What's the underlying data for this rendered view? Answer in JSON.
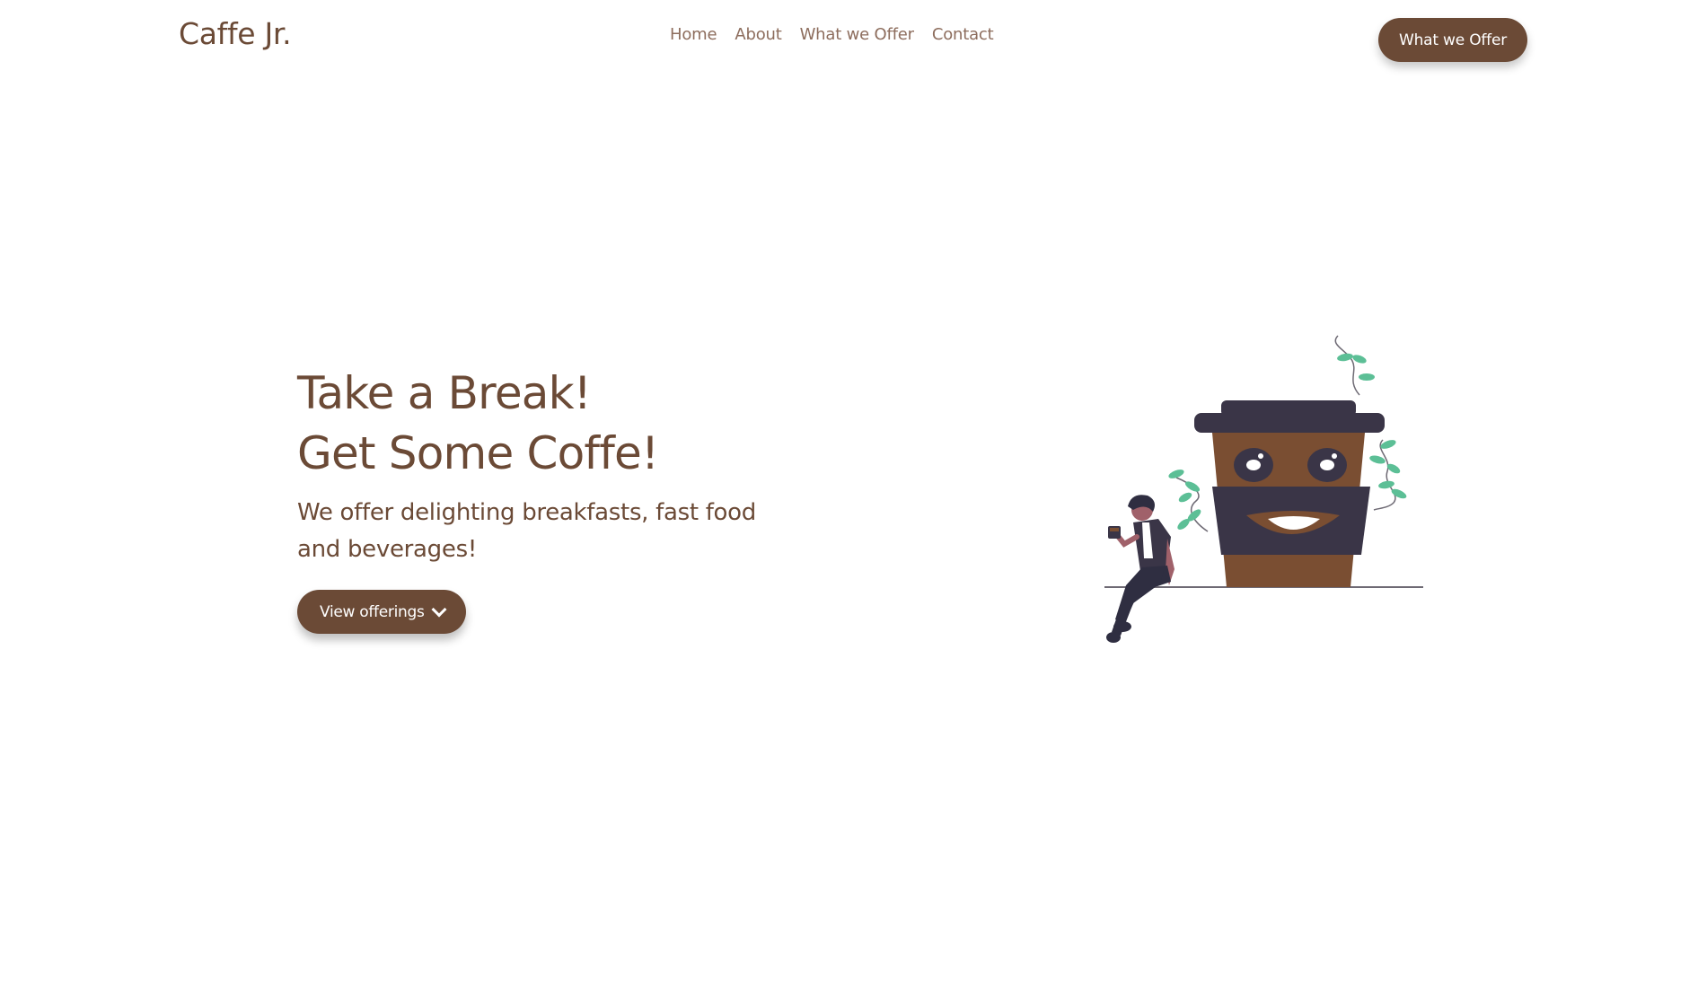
{
  "brand": "Caffe Jr.",
  "nav": {
    "links": [
      "Home",
      "About",
      "What we Offer",
      "Contact"
    ],
    "cta_label": "What we Offer"
  },
  "hero": {
    "title_line1": "Take a Break!",
    "title_line2": "Get Some Coffe!",
    "subtitle_line1": "We offer delighting breakfasts, fast food",
    "subtitle_line2": "and beverages!",
    "button_label": "View offerings",
    "button_icon": "chevron-down-icon"
  },
  "colors": {
    "brand": "#6b4a36",
    "nav_link": "#8d6d5d",
    "cup_body": "#7a4e32",
    "cup_dark": "#3a3547",
    "leaf": "#5cbf96"
  }
}
